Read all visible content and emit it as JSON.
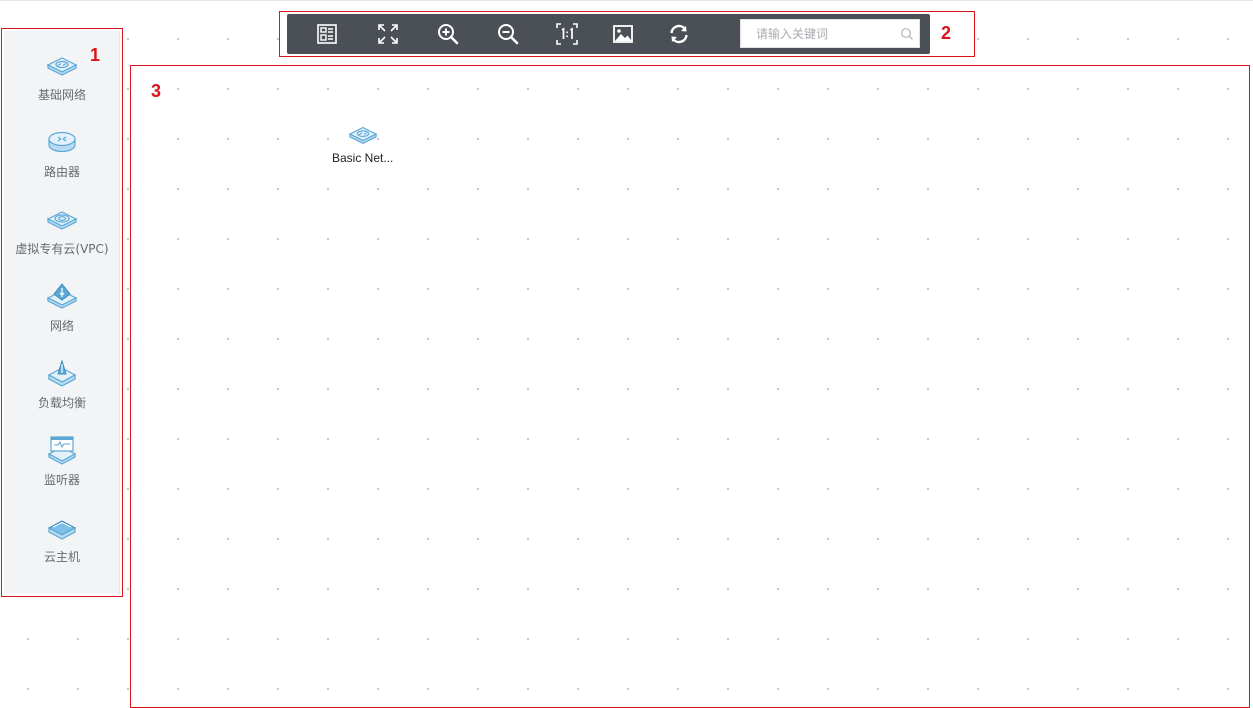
{
  "palette": {
    "items": [
      {
        "label": "基础网络",
        "icon": "basic-network-icon"
      },
      {
        "label": "路由器",
        "icon": "router-icon"
      },
      {
        "label": "虚拟专有云(VPC)",
        "icon": "vpc-icon"
      },
      {
        "label": "网络",
        "icon": "network-icon"
      },
      {
        "label": "负载均衡",
        "icon": "load-balancer-icon"
      },
      {
        "label": "监听器",
        "icon": "listener-icon"
      },
      {
        "label": "云主机",
        "icon": "cloud-host-icon"
      }
    ]
  },
  "toolbar": {
    "buttons": [
      {
        "name": "overview",
        "icon": "overview-icon"
      },
      {
        "name": "fit-screen",
        "icon": "fullscreen-icon"
      },
      {
        "name": "zoom-in",
        "icon": "zoom-in-icon"
      },
      {
        "name": "zoom-out",
        "icon": "zoom-out-icon"
      },
      {
        "name": "actual-size",
        "icon": "actual-size-icon"
      },
      {
        "name": "export-image",
        "icon": "image-icon"
      },
      {
        "name": "refresh",
        "icon": "refresh-icon"
      }
    ],
    "search": {
      "placeholder": "请输入关键词",
      "value": ""
    }
  },
  "canvas": {
    "nodes": [
      {
        "label": "Basic Net...",
        "icon": "basic-network-icon"
      }
    ]
  },
  "annotations": {
    "a1": "1",
    "a2": "2",
    "a3": "3"
  },
  "colors": {
    "annotation": "#d9141b",
    "toolbar": "#4a5056",
    "palette_bg": "#f3f4f6",
    "icon_blue": "#5ba8d6"
  }
}
